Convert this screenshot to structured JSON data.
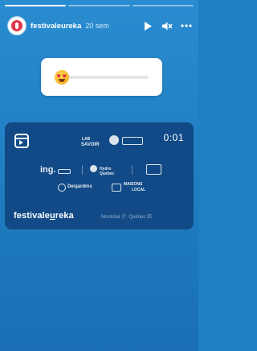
{
  "header": {
    "account_handle": "festivaleureka",
    "time_ago": "20 sem",
    "icons": [
      "play-icon",
      "mute-icon",
      "more-icon"
    ]
  },
  "progress": {
    "segments": 3,
    "current_index": 0
  },
  "slider_sticker": {
    "emoji": "heart-eyes",
    "value": 0.05
  },
  "video": {
    "duration": "0:01",
    "logos": {
      "lab": "LAB",
      "savoir": "SAVOIR",
      "ing": "ing.",
      "hydro": "Hydro Québec",
      "desjardins": "Desjardins",
      "mansions": "MAISONS",
      "mansions_sub": "LOCAL"
    },
    "brand_prefix": "festivale",
    "brand_underlined": "u",
    "brand_suffix": "reka",
    "city_text": "Montréal",
    "province_text": "Québec"
  }
}
